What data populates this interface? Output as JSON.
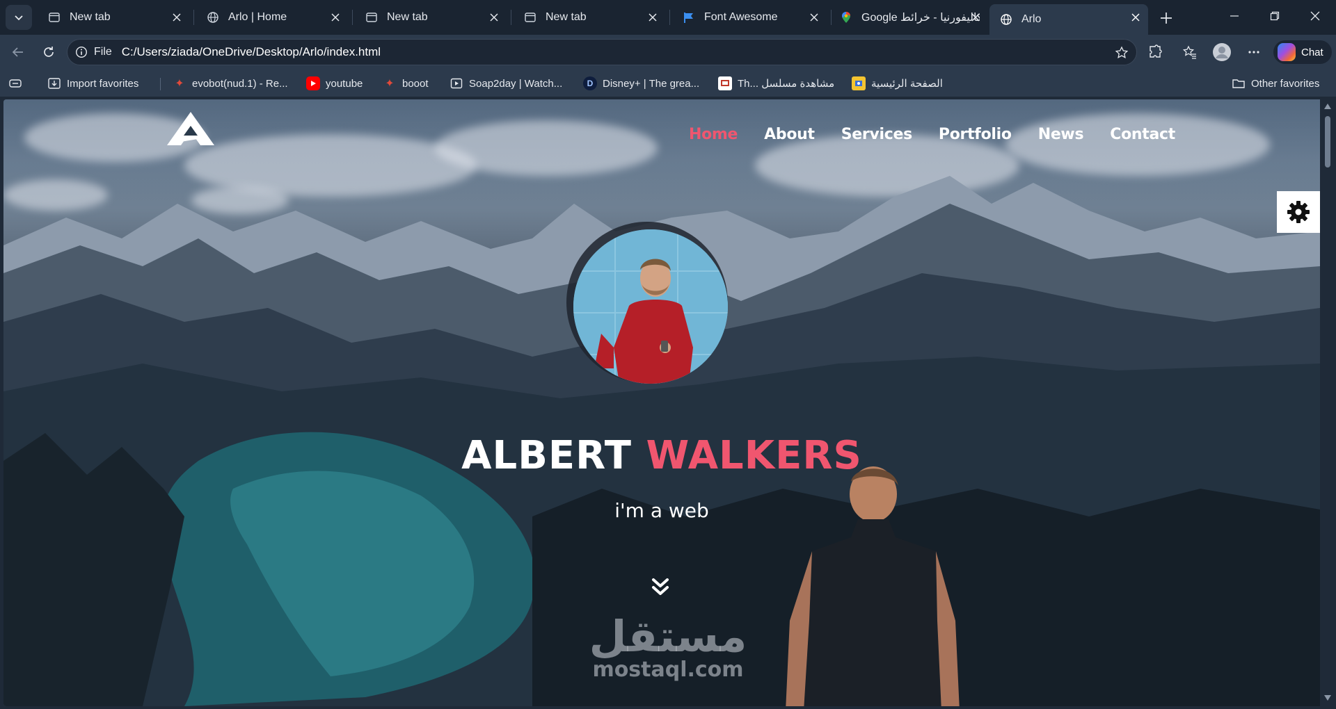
{
  "browser": {
    "tabs": [
      {
        "title": "New tab",
        "icon": "page-icon"
      },
      {
        "title": "Arlo | Home",
        "icon": "globe-icon"
      },
      {
        "title": "New tab",
        "icon": "page-icon"
      },
      {
        "title": "New tab",
        "icon": "page-icon"
      },
      {
        "title": "Font Awesome",
        "icon": "flag-icon"
      },
      {
        "title": "Google كاليفورنيا - خرائط",
        "icon": "maps-pin-icon"
      },
      {
        "title": "Arlo",
        "icon": "globe-icon",
        "active": true
      }
    ],
    "address": {
      "scheme": "File",
      "url": "C:/Users/ziada/OneDrive/Desktop/Arlo/index.html"
    },
    "chat_label": "Chat",
    "favorites": [
      {
        "label": "Import favorites",
        "icon": "import-icon"
      },
      {
        "label": "evobot(nud.1) - Re...",
        "icon": "bot-icon"
      },
      {
        "label": "youtube",
        "icon": "youtube-icon"
      },
      {
        "label": "booot",
        "icon": "bot-icon"
      },
      {
        "label": "Soap2day | Watch...",
        "icon": "film-icon"
      },
      {
        "label": "Disney+ | The grea...",
        "icon": "disney-icon"
      },
      {
        "label": "Th... مشاهدة مسلسل",
        "icon": "tv-icon"
      },
      {
        "label": "الصفحة الرئيسية",
        "icon": "home-icon"
      }
    ],
    "other_favorites": "Other favorites",
    "accent": "#f0566f"
  },
  "site": {
    "nav": [
      {
        "label": "Home",
        "active": true
      },
      {
        "label": "About"
      },
      {
        "label": "Services"
      },
      {
        "label": "Portfolio"
      },
      {
        "label": "News"
      },
      {
        "label": "Contact"
      }
    ],
    "hero": {
      "first_name": "ALBERT",
      "last_name": "WALKERS",
      "tagline": "i'm a web"
    },
    "watermark": {
      "arabic": "مستقل",
      "latin": "mostaql.com"
    }
  }
}
